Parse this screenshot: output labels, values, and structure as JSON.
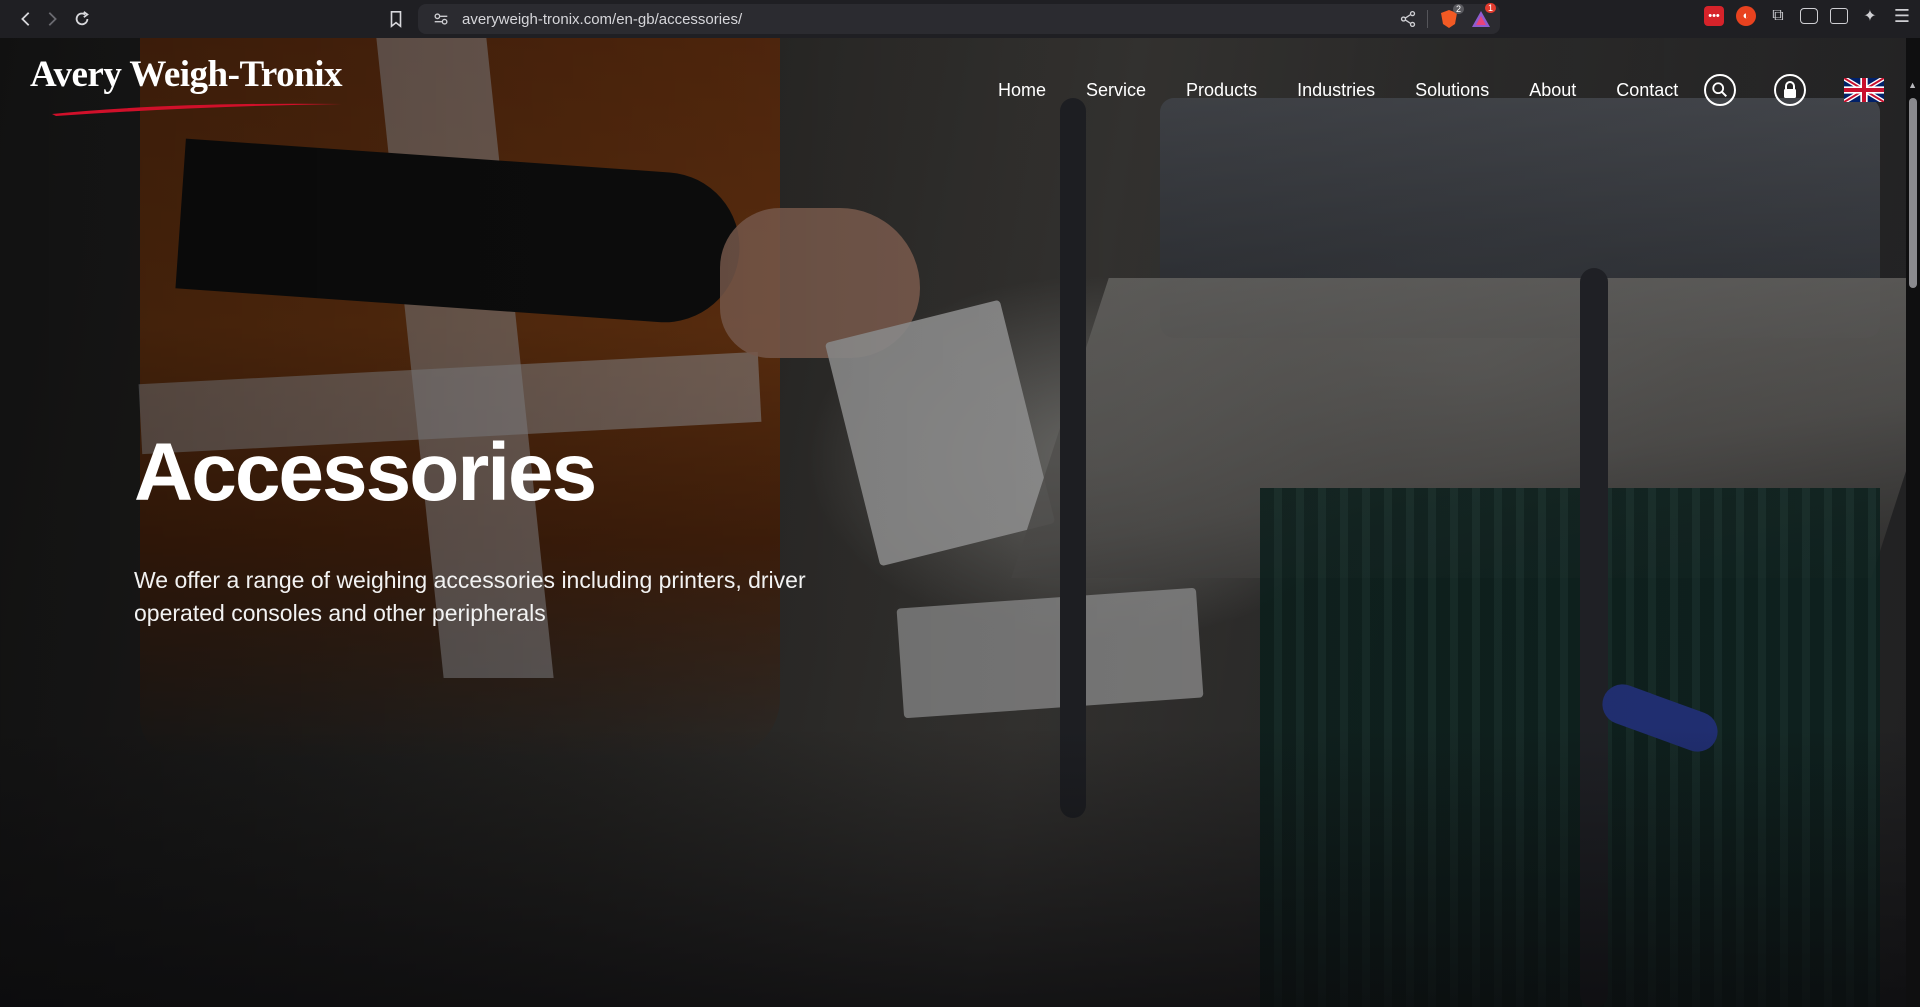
{
  "browser": {
    "url": "averyweigh-tronix.com/en-gb/accessories/",
    "brave_badge": "2",
    "alert_badge": "1"
  },
  "site": {
    "logo_text": "Avery Weigh-Tronix",
    "nav": [
      "Home",
      "Service",
      "Products",
      "Industries",
      "Solutions",
      "About",
      "Contact"
    ]
  },
  "hero": {
    "title": "Accessories",
    "subtitle": "We offer a range of weighing accessories including printers, driver operated consoles and other peripherals"
  },
  "colors": {
    "brand_red": "#d0102a",
    "text_white": "#ffffff"
  },
  "icons": [
    "back-icon",
    "forward-icon",
    "reload-icon",
    "bookmark-icon",
    "site-settings-icon",
    "share-icon",
    "brave-shield-icon",
    "brave-rewards-icon",
    "search-icon",
    "lock-icon",
    "uk-flag-icon"
  ]
}
